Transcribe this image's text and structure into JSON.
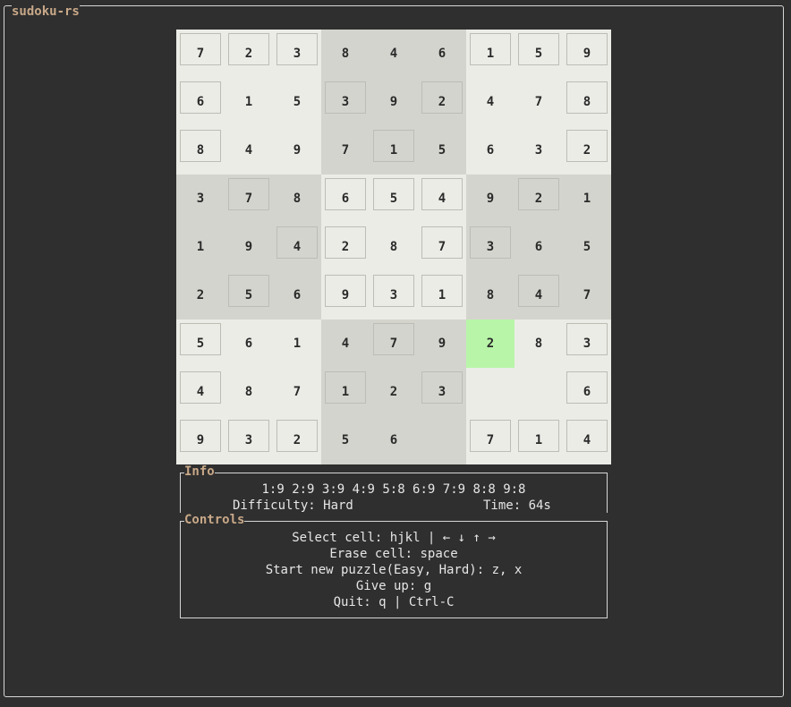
{
  "app_title": "sudoku-rs",
  "colors": {
    "box_light": "#ecece7",
    "box_dark": "#d4d4ce",
    "selected": "#b8f5a8",
    "frame": "#d6d6d6",
    "title": "#c8a888",
    "background": "#2f2f2f"
  },
  "board": {
    "cells": [
      [
        "7",
        "2",
        "3",
        "8",
        "4",
        "6",
        "1",
        "5",
        "9"
      ],
      [
        "6",
        "1",
        "5",
        "3",
        "9",
        "2",
        "4",
        "7",
        "8"
      ],
      [
        "8",
        "4",
        "9",
        "7",
        "1",
        "5",
        "6",
        "3",
        "2"
      ],
      [
        "3",
        "7",
        "8",
        "6",
        "5",
        "4",
        "9",
        "2",
        "1"
      ],
      [
        "1",
        "9",
        "4",
        "2",
        "8",
        "7",
        "3",
        "6",
        "5"
      ],
      [
        "2",
        "5",
        "6",
        "9",
        "3",
        "1",
        "8",
        "4",
        "7"
      ],
      [
        "5",
        "6",
        "1",
        "4",
        "7",
        "9",
        "2",
        "8",
        "3"
      ],
      [
        "4",
        "8",
        "7",
        "1",
        "2",
        "3",
        "",
        "",
        "6"
      ],
      [
        "9",
        "3",
        "2",
        "5",
        "6",
        "",
        "7",
        "1",
        "4"
      ]
    ],
    "given": [
      [
        1,
        1,
        1,
        0,
        0,
        0,
        1,
        1,
        1
      ],
      [
        1,
        0,
        0,
        1,
        0,
        1,
        0,
        0,
        1
      ],
      [
        1,
        0,
        0,
        0,
        1,
        0,
        0,
        0,
        1
      ],
      [
        0,
        1,
        0,
        1,
        1,
        1,
        0,
        1,
        0
      ],
      [
        0,
        0,
        1,
        1,
        0,
        1,
        1,
        0,
        0
      ],
      [
        0,
        1,
        0,
        1,
        1,
        1,
        0,
        1,
        0
      ],
      [
        1,
        0,
        0,
        0,
        1,
        0,
        0,
        0,
        1
      ],
      [
        1,
        0,
        0,
        1,
        0,
        1,
        0,
        0,
        1
      ],
      [
        1,
        1,
        1,
        0,
        0,
        0,
        1,
        1,
        1
      ]
    ],
    "selected": [
      6,
      6
    ]
  },
  "info": {
    "title": "Info",
    "counts": "1:9 2:9 3:9 4:9 5:8 6:9 7:9 8:8 9:8",
    "difficulty": "Difficulty: Hard",
    "time": "Time: 64s"
  },
  "controls": {
    "title": "Controls",
    "lines": [
      "Select cell: hjkl | ← ↓ ↑ →",
      "Erase cell: space",
      "Start new puzzle(Easy, Hard): z, x",
      "Give up: g",
      "Quit: q | Ctrl-C"
    ]
  }
}
